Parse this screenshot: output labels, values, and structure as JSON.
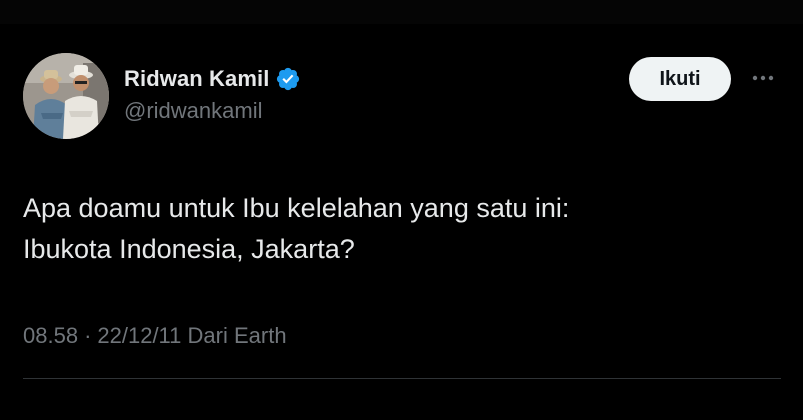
{
  "tweet": {
    "author": {
      "display_name": "Ridwan Kamil",
      "handle": "@ridwankamil",
      "verified": true,
      "verified_color": "#1d9bf0"
    },
    "follow_label": "Ikuti",
    "more_icon": "more-horizontal-icon",
    "text_lines": [
      "Apa doamu untuk Ibu kelelahan yang satu ini:",
      "Ibukota Indonesia, Jakarta?"
    ],
    "meta": {
      "time": "08.58",
      "separator": "·",
      "date": "22/12/11",
      "source": "Dari Earth"
    }
  },
  "colors": {
    "background": "#000000",
    "text": "#e7e9ea",
    "secondary": "#71767b",
    "follow_bg": "#eff3f4",
    "divider": "#2f3336"
  }
}
